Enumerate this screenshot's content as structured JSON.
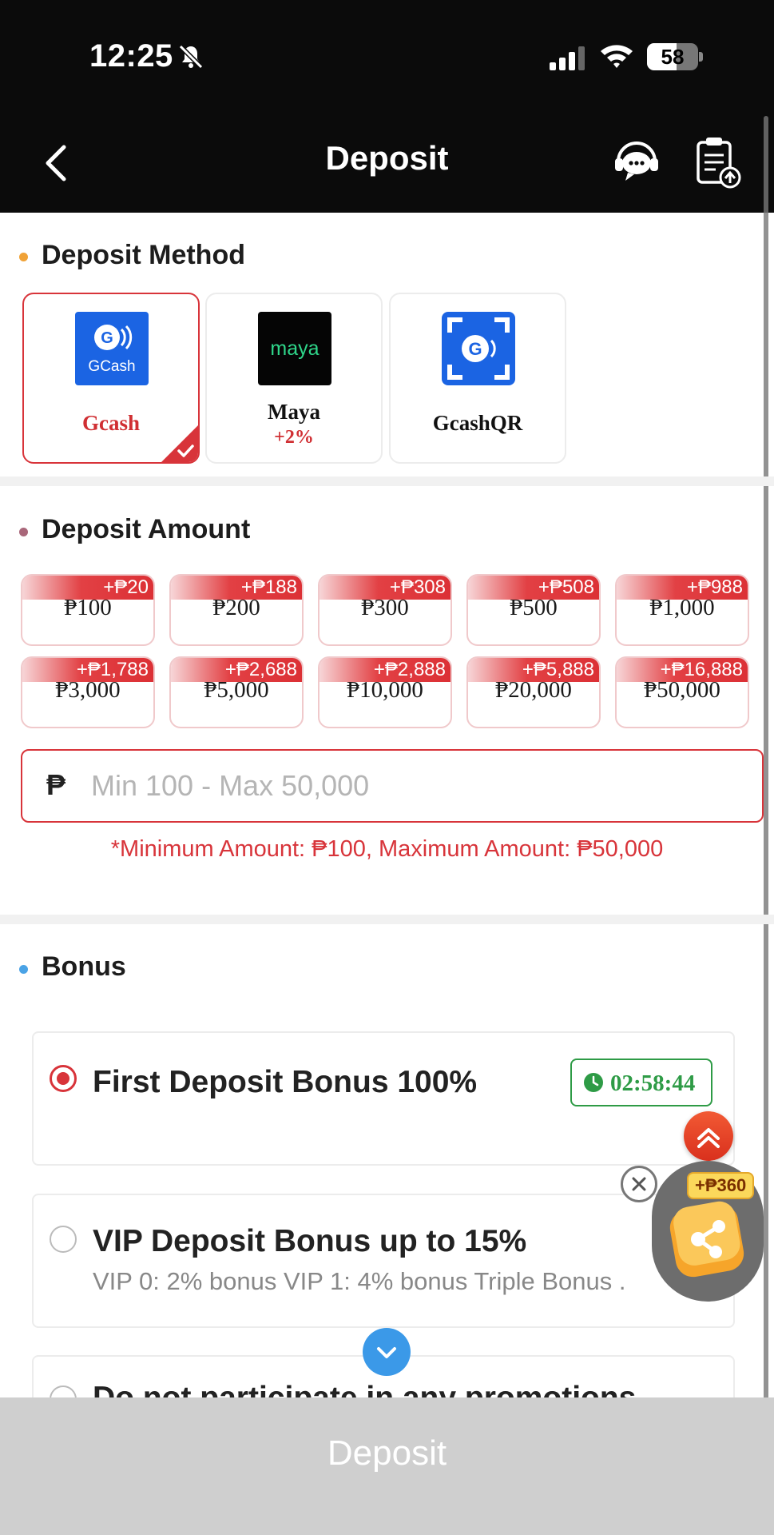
{
  "status": {
    "time": "12:25",
    "battery": "58",
    "battery_level": 0.58
  },
  "nav": {
    "title": "Deposit"
  },
  "method_section": {
    "title": "Deposit Method",
    "methods": [
      {
        "name": "Gcash",
        "logo_text": "GCash",
        "extra": "",
        "selected": true
      },
      {
        "name": "Maya",
        "logo_text": "maya",
        "extra": "+2%",
        "selected": false
      },
      {
        "name": "GcashQR",
        "logo_text": "",
        "extra": "",
        "selected": false
      }
    ]
  },
  "amount_section": {
    "title": "Deposit Amount",
    "chips": [
      {
        "amount": "₱100",
        "bonus": "+₱20"
      },
      {
        "amount": "₱200",
        "bonus": "+₱188"
      },
      {
        "amount": "₱300",
        "bonus": "+₱308"
      },
      {
        "amount": "₱500",
        "bonus": "+₱508"
      },
      {
        "amount": "₱1,000",
        "bonus": "+₱988"
      },
      {
        "amount": "₱3,000",
        "bonus": "+₱1,788"
      },
      {
        "amount": "₱5,000",
        "bonus": "+₱2,688"
      },
      {
        "amount": "₱10,000",
        "bonus": "+₱2,888"
      },
      {
        "amount": "₱20,000",
        "bonus": "+₱5,888"
      },
      {
        "amount": "₱50,000",
        "bonus": "+₱16,888"
      }
    ],
    "currency_symbol": "₱",
    "input_placeholder": "Min 100 - Max 50,000",
    "input_value": "",
    "limit_note": "*Minimum Amount: ₱100, Maximum Amount: ₱50,000"
  },
  "bonus_section": {
    "title": "Bonus",
    "options": [
      {
        "title": "First Deposit Bonus 100%",
        "desc": "",
        "selected": true,
        "timer": "02:58:44"
      },
      {
        "title": "VIP Deposit Bonus up to 15%",
        "desc": "VIP 0: 2% bonus VIP 1: 4% bonus Triple Bonus .",
        "selected": false
      },
      {
        "title": "Do not participate in any promotions",
        "desc": "",
        "selected": false
      }
    ]
  },
  "float_promo": {
    "badge": "+₱360"
  },
  "submit": {
    "label": "Deposit"
  },
  "colors": {
    "accent": "#d8343a",
    "nav_bg": "#0b0b0b",
    "timer": "#2e9b46",
    "button_disabled": "#cfcfcf"
  }
}
